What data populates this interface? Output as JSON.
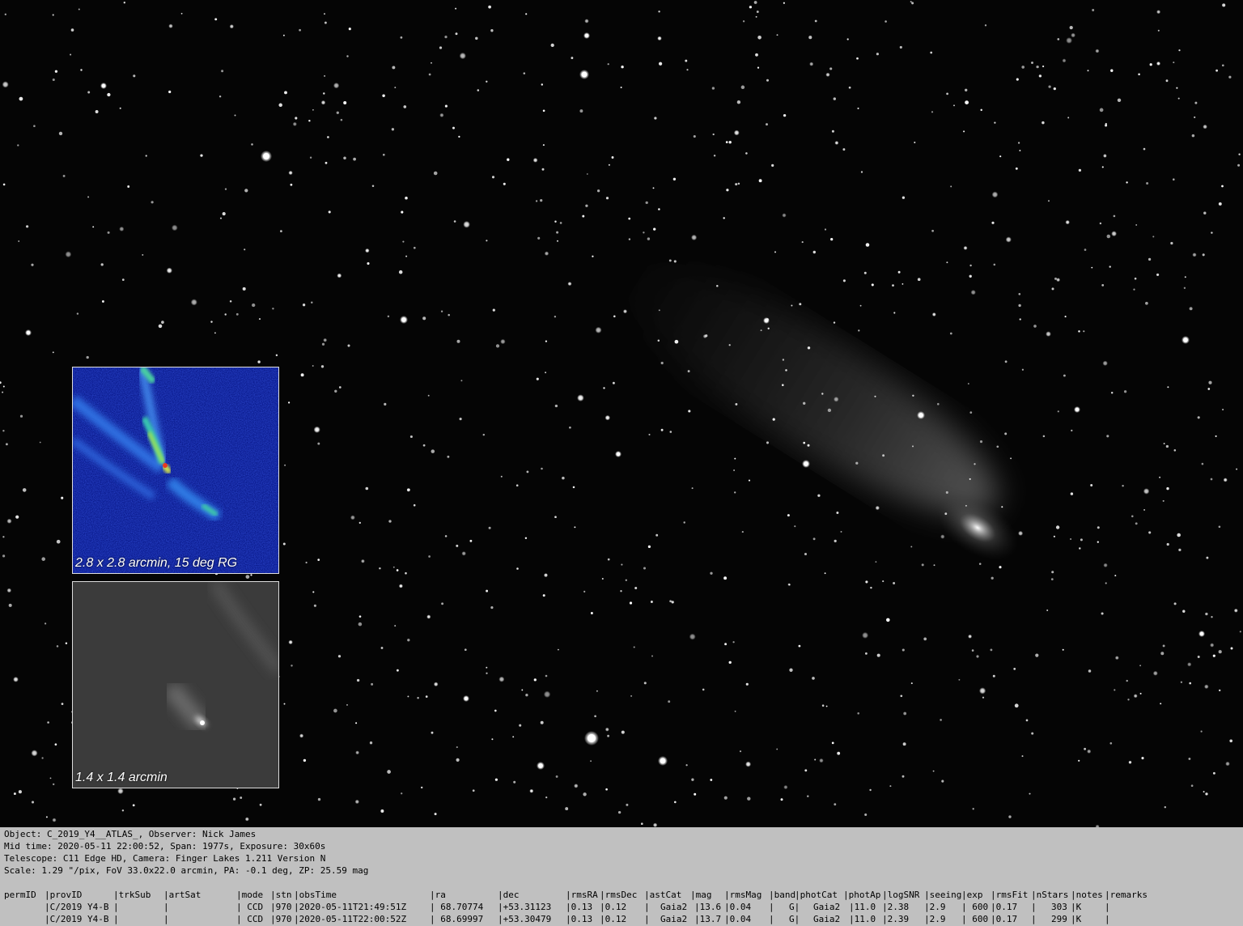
{
  "insets": {
    "rg_caption": "2.8 x 2.8 arcmin, 15 deg RG",
    "gray_caption": "1.4 x 1.4 arcmin"
  },
  "info": {
    "object_line": "Object: C_2019_Y4__ATLAS_, Observer: Nick James",
    "time_line": "Mid time: 2020-05-11 22:00:52, Span: 1977s, Exposure: 30x60s",
    "telescope_line": "Telescope: C11 Edge HD, Camera: Finger Lakes 1.211 Version N",
    "scale_line": "Scale: 1.29 \"/pix, FoV 33.0x22.0 arcmin, PA: -0.1 deg, ZP: 25.59 mag"
  },
  "table": {
    "headers": [
      "permID",
      "|provID",
      "|trkSub",
      "|artSat",
      "|mode",
      "|stn",
      "|obsTime",
      "|ra",
      "|dec",
      "|rmsRA",
      "|rmsDec",
      "|astCat",
      "|mag",
      "|rmsMag",
      "|band",
      "|photCat",
      "|photAp",
      "|logSNR",
      "|seeing",
      "|exp",
      "|rmsFit",
      "|nStars",
      "|notes",
      "|remarks"
    ],
    "rows": [
      [
        "",
        "|C/2019 Y4-B",
        "|",
        "|",
        "| CCD",
        "|970",
        "|2020-05-11T21:49:51Z",
        "| 68.70774",
        "|+53.31123",
        "|0.13",
        "|0.12",
        "|",
        "Gaia2",
        "|13.6",
        "|0.04",
        "|",
        "G|",
        "Gaia2",
        "|11.0",
        "|2.38",
        "|2.9",
        "| 600",
        "|0.17",
        "|",
        "303",
        "|K",
        "|"
      ],
      [
        "",
        "|C/2019 Y4-B",
        "|",
        "|",
        "| CCD",
        "|970",
        "|2020-05-11T22:00:52Z",
        "| 68.69997",
        "|+53.30479",
        "|0.13",
        "|0.12",
        "|",
        "Gaia2",
        "|13.7",
        "|0.04",
        "|",
        "G|",
        "Gaia2",
        "|11.0",
        "|2.39",
        "|2.9",
        "| 600",
        "|0.17",
        "|",
        "299",
        "|K",
        "|"
      ]
    ]
  }
}
